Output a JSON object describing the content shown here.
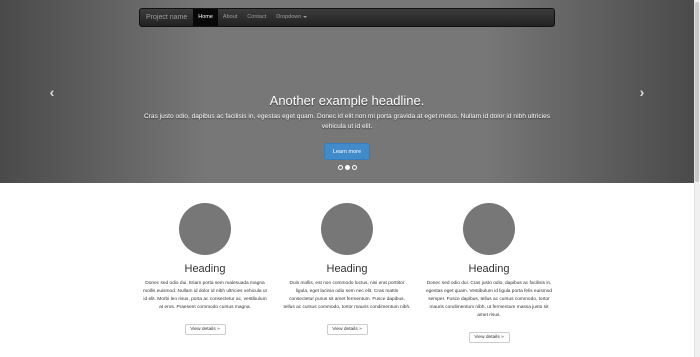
{
  "navbar": {
    "brand": "Project name",
    "items": [
      {
        "label": "Home",
        "active": true
      },
      {
        "label": "About",
        "active": false
      },
      {
        "label": "Contact",
        "active": false
      },
      {
        "label": "Dropdown",
        "active": false
      }
    ]
  },
  "carousel": {
    "headline": "Another example headline.",
    "lead": "Cras justo odio, dapibus ac facilisis in, egestas eget quam. Donec id elit non mi porta gravida at eget metus. Nullam id dolor id nibh ultricies vehicula ut id elit.",
    "button_label": "Learn more",
    "prev_icon": "chevron-left-icon",
    "next_icon": "chevron-right-icon",
    "slide_count": 3,
    "active_slide": 2
  },
  "marketing": {
    "columns": [
      {
        "heading": "Heading",
        "text": "Donec sed odio dui. Etiam porta sem malesuada magna mollis euismod. Nullam id dolor id nibh ultricies vehicula ut id elit. Morbi leo risus, porta ac consectetur ac, vestibulum at eros. Praesent commodo cursus magna.",
        "button_label": "View details »"
      },
      {
        "heading": "Heading",
        "text": "Duis mollis, est non commodo luctus, nisi erat porttitor ligula, eget lacinia odio sem nec elit. Cras mattis consectetur purus sit amet fermentum. Fusce dapibus, tellus ac cursus commodo, tortor mauris condimentum nibh.",
        "button_label": "View details »"
      },
      {
        "heading": "Heading",
        "text": "Donec sed odio dui. Cras justo odio, dapibus ac facilisis in, egestas eget quam. Vestibulum id ligula porta felis euismod semper. Fusce dapibus, tellus ac cursus commodo, tortor mauris condimentum nibh, ut fermentum massa justo sit amet risus.",
        "button_label": "View details »"
      }
    ]
  },
  "colors": {
    "accent": "#428bca",
    "navbar_bg": "#222222",
    "carousel_bg": "#777777",
    "circle_fill": "#777777"
  }
}
